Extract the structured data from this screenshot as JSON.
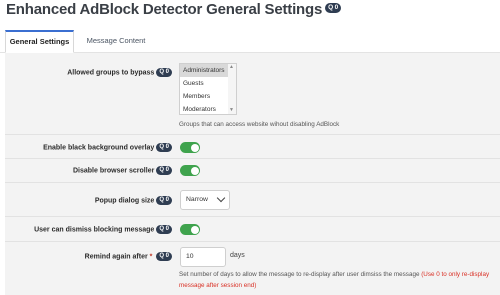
{
  "page": {
    "title": "Enhanced AdBlock Detector General Settings",
    "title_badge": "Q 0"
  },
  "tabs": [
    {
      "label": "General Settings",
      "active": true
    },
    {
      "label": "Message Content",
      "active": false
    }
  ],
  "settings": {
    "allowed_groups": {
      "label": "Allowed groups to bypass",
      "badge": "Q 0",
      "options": [
        "Administrators",
        "Guests",
        "Members",
        "Moderators"
      ],
      "selected": "Administrators",
      "help": "Groups that can access website wihout disabling AdBlock"
    },
    "black_overlay": {
      "label": "Enable black background overlay",
      "badge": "Q 0",
      "enabled": true
    },
    "disable_scroller": {
      "label": "Disable browser scroller",
      "badge": "Q 0",
      "enabled": true
    },
    "popup_size": {
      "label": "Popup dialog size",
      "badge": "Q 0",
      "value": "Narrow"
    },
    "dismiss_message": {
      "label": "User can dismiss blocking message",
      "badge": "Q 0",
      "enabled": true
    },
    "remind_again": {
      "label": "Remind again after",
      "required_mark": "*",
      "badge": "Q 0",
      "value": "10",
      "unit": "days",
      "help": "Set number of days to allow the message to re-display after user dimsiss the message",
      "help_note_line1": "(Use 0 to only re-display",
      "help_note_line2": "message after session end)"
    }
  },
  "colors": {
    "toggle_on": "#3fa34d",
    "badge_bg": "#2f3d52",
    "tab_accent": "#3b6fd1",
    "note_red": "#d93025"
  }
}
